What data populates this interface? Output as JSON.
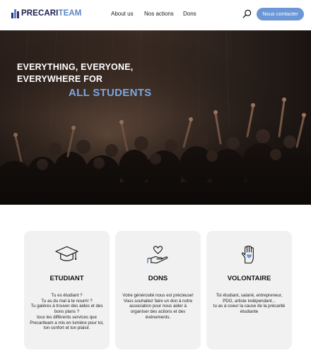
{
  "header": {
    "logo": {
      "part1": "PRECARI",
      "part2": "TEAM"
    },
    "nav": [
      {
        "label": "About us"
      },
      {
        "label": "Nos actions"
      },
      {
        "label": "Dons"
      }
    ],
    "search_icon": "search-icon",
    "contact_label": "Nous contacter",
    "accent_color": "#6c97d6"
  },
  "hero": {
    "title_lines": [
      "EVERYTHING, EVERYONE,",
      "EVERYWHERE FOR"
    ],
    "accent": "ALL STUDENTS",
    "accent_color": "#7ea7e0"
  },
  "cards": [
    {
      "icon": "graduation-cap-icon",
      "title": "ETUDIANT",
      "text": "Tu es étudiant ?\nTu as du mal à te nourrir ?\nTu galères à trouver des aides et des bons plans ?\ntous les différents services que Precariteam a mis en lumière pour toi, ton confort et ton plaisir."
    },
    {
      "icon": "hand-heart-icon",
      "title": "DONS",
      "text": "Votre générosité nous est précieuse! Vous souhaitez faire un don à notre association pour nous aider à organiser des actions et des évènements."
    },
    {
      "icon": "hand-heart-volunteer-icon",
      "title": "VOLONTAIRE",
      "text": "Toi étudiant, salarié, entrepreneur, PDG, artiste indépendant...\ntu as à coeur la cause de la précarité étudiante"
    }
  ]
}
